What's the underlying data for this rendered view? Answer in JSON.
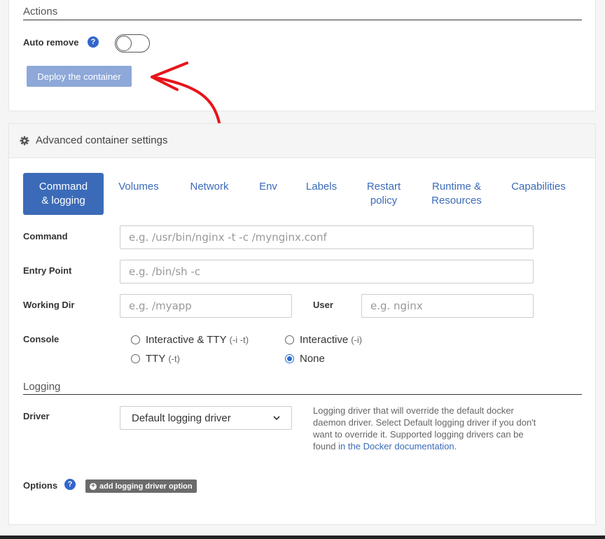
{
  "actions": {
    "title": "Actions",
    "auto_remove_label": "Auto remove",
    "help_glyph": "?",
    "deploy_label": "Deploy the container"
  },
  "advanced": {
    "title": "Advanced container settings",
    "tabs": [
      {
        "line1": "Command",
        "line2": "& logging",
        "active": true
      },
      {
        "line1": "Volumes",
        "line2": ""
      },
      {
        "line1": "Network",
        "line2": ""
      },
      {
        "line1": "Env",
        "line2": ""
      },
      {
        "line1": "Labels",
        "line2": ""
      },
      {
        "line1": "Restart",
        "line2": "policy"
      },
      {
        "line1": "Runtime &",
        "line2": "Resources"
      },
      {
        "line1": "Capabilities",
        "line2": ""
      }
    ],
    "command": {
      "label": "Command",
      "placeholder": "e.g. /usr/bin/nginx -t -c /mynginx.conf"
    },
    "entry_point": {
      "label": "Entry Point",
      "placeholder": "e.g. /bin/sh -c"
    },
    "working_dir": {
      "label": "Working Dir",
      "placeholder": "e.g. /myapp"
    },
    "user": {
      "label": "User",
      "placeholder": "e.g. nginx"
    },
    "console": {
      "label": "Console",
      "options": [
        {
          "label": "Interactive & TTY",
          "hint": "(-i -t)",
          "checked": false
        },
        {
          "label": "Interactive",
          "hint": "(-i)",
          "checked": false
        },
        {
          "label": "TTY",
          "hint": "(-t)",
          "checked": false
        },
        {
          "label": "None",
          "hint": "",
          "checked": true
        }
      ]
    },
    "logging": {
      "title": "Logging",
      "driver_label": "Driver",
      "driver_value": "Default logging driver",
      "help_text": "Logging driver that will override the default docker daemon driver. Select Default logging driver if you don't want to override it. Supported logging drivers can be found",
      "help_link": "in the Docker documentation",
      "help_end": ".",
      "options_label": "Options",
      "add_option_label": "add logging driver option"
    }
  },
  "colors": {
    "accent": "#3b6bb8",
    "arrow": "#e8141b"
  },
  "icons": {
    "gear": "gear-icon",
    "help": "question-circle-icon",
    "plus": "plus-circle-icon",
    "chevron": "chevron-down-icon"
  }
}
